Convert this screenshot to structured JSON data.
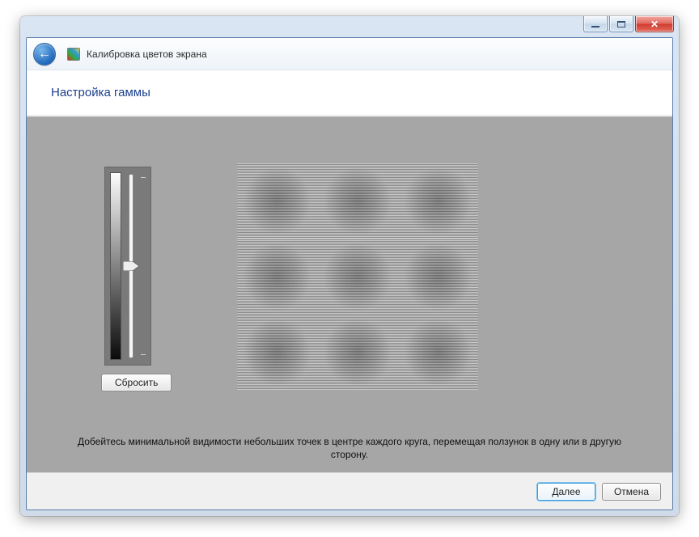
{
  "window": {
    "app_title": "Калибровка цветов экрана"
  },
  "page": {
    "heading": "Настройка гаммы",
    "instruction": "Добейтесь минимальной видимости небольших точек в центре каждого круга, перемещая ползунок в одну или в другую сторону."
  },
  "controls": {
    "reset_label": "Сбросить",
    "next_label": "Далее",
    "cancel_label": "Отмена"
  },
  "slider": {
    "value_percent": 50
  }
}
